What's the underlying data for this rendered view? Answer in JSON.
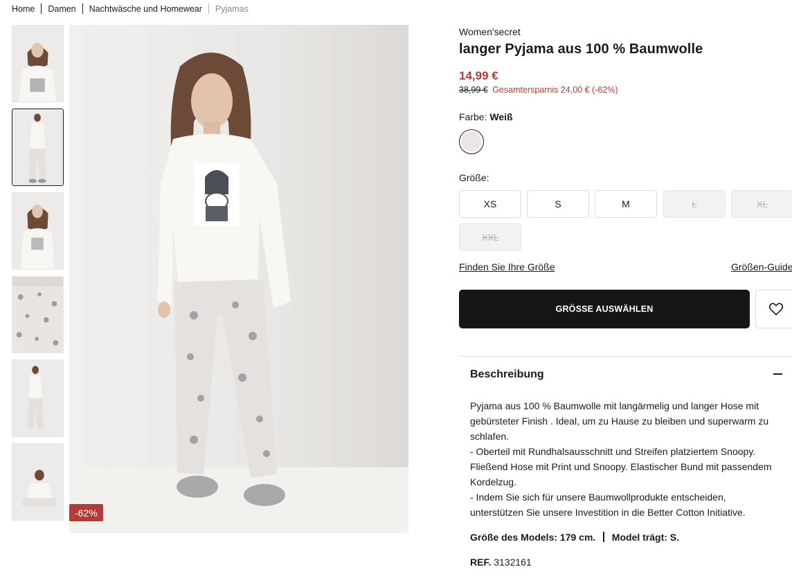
{
  "breadcrumb": [
    "Home",
    "Damen",
    "Nachtwäsche und Homewear",
    "Pyjamas"
  ],
  "gallery": {
    "thumbnail_count": 6,
    "active_thumbnail": 2,
    "discount_badge": "-62%"
  },
  "product": {
    "brand": "Women'secret",
    "title": "langer Pyjama aus 100 % Baumwolle",
    "price": "14,99 €",
    "old_price": "38,99 €",
    "savings": "Gesamtersparnis 24,00 € (-62%)",
    "color_label": "Farbe:",
    "color_value": "Weiß",
    "swatch_color": "#ece7e6",
    "size_label": "Größe:",
    "sizes": [
      {
        "label": "XS",
        "available": true
      },
      {
        "label": "S",
        "available": true
      },
      {
        "label": "M",
        "available": true
      },
      {
        "label": "L",
        "available": false
      },
      {
        "label": "XL",
        "available": false
      },
      {
        "label": "XXL",
        "available": false
      }
    ],
    "find_size_link": "Finden Sie Ihre Größe",
    "size_guide_link": "Größen-Guide",
    "cta_label": "GRÖSSE AUSWÄHLEN",
    "wishlist_icon": "heart-icon"
  },
  "description": {
    "heading": "Beschreibung",
    "lines": [
      "Pyjama aus 100 % Baumwolle mit langärmelig und langer Hose mit gebürsteter Finish . Ideal, um zu Hause zu bleiben und superwarm zu schlafen.",
      "- Oberteil mit Rundhalsausschnitt und Streifen platziertem Snoopy. Fließend Hose mit Print und Snoopy. Elastischer Bund mit passendem Kordelzug.",
      "- Indem Sie sich für unsere Baumwollprodukte entscheiden, unterstützen Sie unsere Investition in die Better Cotton Initiative."
    ],
    "model_size": "Größe des Models: 179 cm.",
    "model_wears": "Model trägt: S.",
    "ref_label": "REF.",
    "ref_value": "3132161"
  },
  "colors": {
    "sale": "#b53a3a",
    "cta_bg": "#161616",
    "disabled_bg": "#f2f2f2"
  }
}
